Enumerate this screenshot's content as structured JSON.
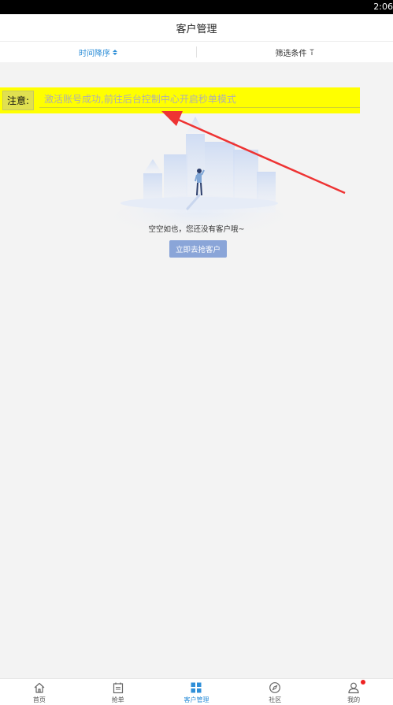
{
  "status_bar": {
    "time": "2:06"
  },
  "header": {
    "title": "客户管理"
  },
  "filters": {
    "sort_label": "时间降序",
    "condition_label": "筛选条件"
  },
  "notice": {
    "label": "注意:",
    "placeholder": "激活账号成功,前往后台控制中心开启秒单模式"
  },
  "empty_state": {
    "message": "空空如也，您还没有客户哦~",
    "cta_label": "立即去抢客户"
  },
  "tabbar": {
    "items": [
      {
        "label": "首页",
        "icon": "home-icon"
      },
      {
        "label": "抢单",
        "icon": "clipboard-icon"
      },
      {
        "label": "客户管理",
        "icon": "grid-icon",
        "active": true
      },
      {
        "label": "社区",
        "icon": "compass-icon"
      },
      {
        "label": "我的",
        "icon": "user-icon",
        "badge": true
      }
    ]
  },
  "colors": {
    "accent": "#2f8fd8",
    "notice_bg": "#ffff00",
    "cta_bg": "#8aa5d8",
    "arrow": "#ee3333"
  }
}
